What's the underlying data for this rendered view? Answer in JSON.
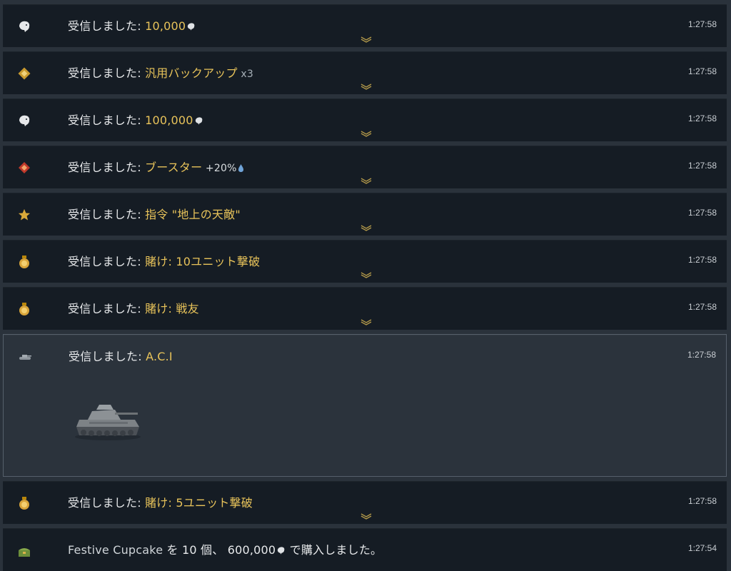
{
  "colors": {
    "row_bg": "#151c24",
    "expanded_bg": "#2b333c",
    "highlight": "#e8c35a",
    "text": "#e8eaec",
    "time": "#c9ced3"
  },
  "prefix": "受信しました: ",
  "rows": [
    {
      "icon": "lion-icon",
      "item": "10,000",
      "time": "1:27:58"
    },
    {
      "icon": "backup-icon",
      "item": "汎用バックアップ",
      "qty": " x3",
      "time": "1:27:58"
    },
    {
      "icon": "lion-icon",
      "item": "100,000",
      "time": "1:27:58"
    },
    {
      "icon": "booster-icon",
      "item": "ブースター",
      "boost": " +20%",
      "time": "1:27:58"
    },
    {
      "icon": "star-icon",
      "item": "指令 \"地上の天敵\"",
      "time": "1:27:58"
    },
    {
      "icon": "wager-icon",
      "item": "賭け",
      "item2": ": ",
      "item3": "10ユニット撃破",
      "time": "1:27:58"
    },
    {
      "icon": "wager-icon",
      "item": "賭け",
      "item2": ": ",
      "item3": "戦友",
      "time": "1:27:58"
    },
    {
      "icon": "tank-icon",
      "item": "A.C.I",
      "time": "1:27:58"
    },
    {
      "icon": "wager-icon",
      "item": "賭け",
      "item2": ": ",
      "item3": "5ユニット撃破",
      "time": "1:27:58"
    }
  ],
  "purchase": {
    "icon": "chest-icon",
    "item": "Festive Cupcake",
    "part1": " を 10 個、 ",
    "price": "600,000",
    "part2": " で購入しました。",
    "time": "1:27:54"
  }
}
